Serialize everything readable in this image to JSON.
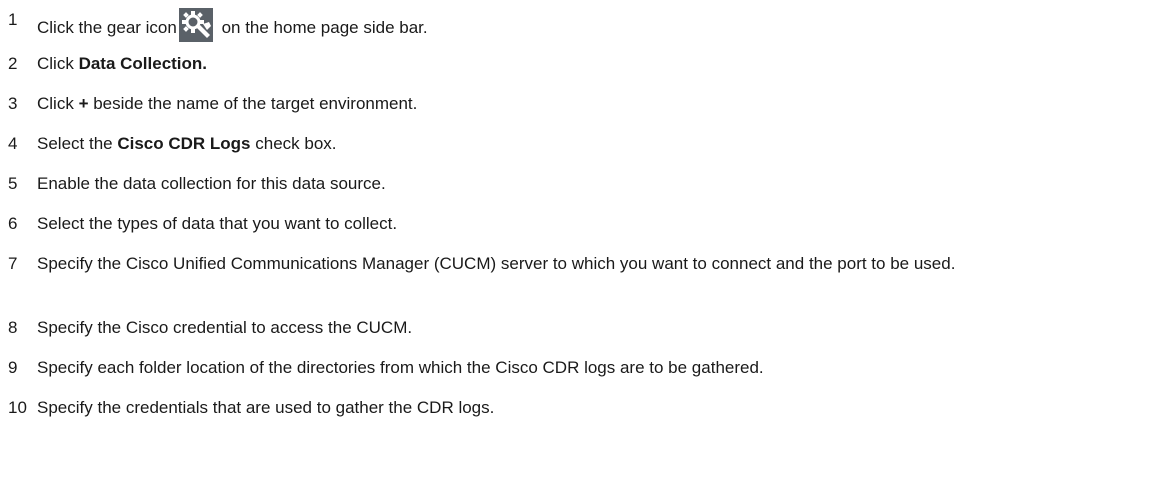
{
  "steps": [
    {
      "num": "1",
      "pre": "Click the gear icon",
      "post": "on the home page side bar.",
      "icon": "gear-icon"
    },
    {
      "num": "2",
      "pre": "Click ",
      "bold": "Data Collection."
    },
    {
      "num": "3",
      "pre": "Click ",
      "bold": "+",
      "post": " beside the name of the target environment."
    },
    {
      "num": "4",
      "pre": "Select the ",
      "bold": "Cisco CDR Logs",
      "post": " check box."
    },
    {
      "num": "5",
      "pre": "Enable the data collection for this data source."
    },
    {
      "num": "6",
      "pre": "Select the types of data that you want to collect."
    },
    {
      "num": "7",
      "pre": "Specify the Cisco Unified Communications Manager (CUCM) server to which you want to connect and the port to be used."
    },
    {
      "num": "8",
      "pre": "Specify the Cisco credential to access the CUCM."
    },
    {
      "num": "9",
      "pre": "Specify each folder location of the directories from which the Cisco CDR logs are to be gathered."
    },
    {
      "num": "10",
      "pre": "Specify the credentials that are used to gather the CDR logs."
    }
  ],
  "colors": {
    "text": "#1a1a1a",
    "icon_bg": "#5a6168",
    "icon_fg": "#ffffff"
  }
}
